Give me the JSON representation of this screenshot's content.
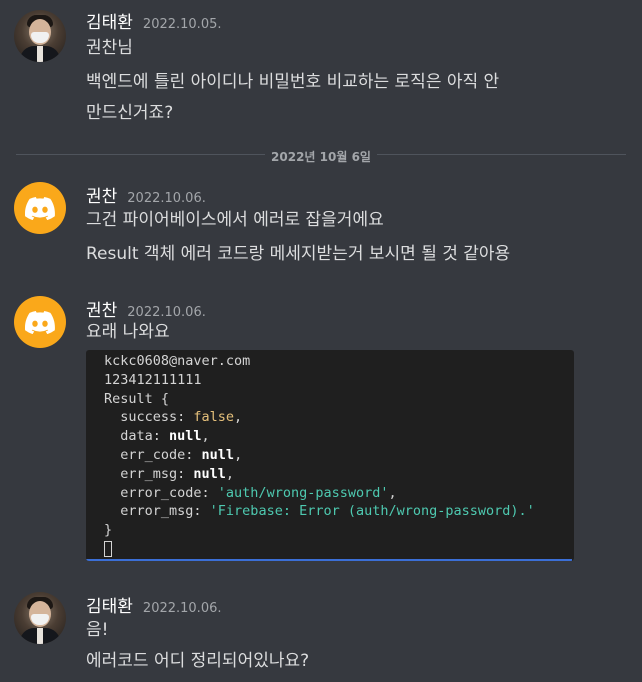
{
  "messages": [
    {
      "username": "김태환",
      "timestamp": "2022.10.05.",
      "lines": [
        "권찬님",
        "백엔드에 틀린 아이디나 비밀번호 비교하는 로직은 아직 안",
        "만드신거죠?"
      ]
    },
    {
      "username": "권찬",
      "timestamp": "2022.10.06.",
      "lines": [
        "그건 파이어베이스에서 에러로 잡을거에요",
        "Result 객체 에러 코드랑 메세지받는거 보시면 될 것 같아용"
      ]
    },
    {
      "username": "권찬",
      "timestamp": "2022.10.06.",
      "lines": [
        "요래 나와요"
      ]
    },
    {
      "username": "김태환",
      "timestamp": "2022.10.06.",
      "lines": [
        "음!",
        "에러코드 어디 정리되어있나요?"
      ]
    }
  ],
  "date_divider": "2022년 10월 6일",
  "code_screenshot": {
    "email": "kckc0608@naver.com",
    "password": "123412111111",
    "result_open": "Result {",
    "success_key": "  success: ",
    "success_val": "false",
    "data_key": "  data: ",
    "data_val": "null",
    "err_code_key": "  err_code: ",
    "err_code_val": "null",
    "err_msg_key": "  err_msg: ",
    "err_msg_val": "null",
    "error_code_key": "  error_code: ",
    "error_code_val": "'auth/wrong-password'",
    "error_msg_key": "  error_msg: ",
    "error_msg_val": "'Firebase: Error (auth/wrong-password).'",
    "result_close": "}"
  },
  "icons": {
    "discord_avatar": "discord-logo-icon",
    "discord_color": "#faa81a"
  }
}
